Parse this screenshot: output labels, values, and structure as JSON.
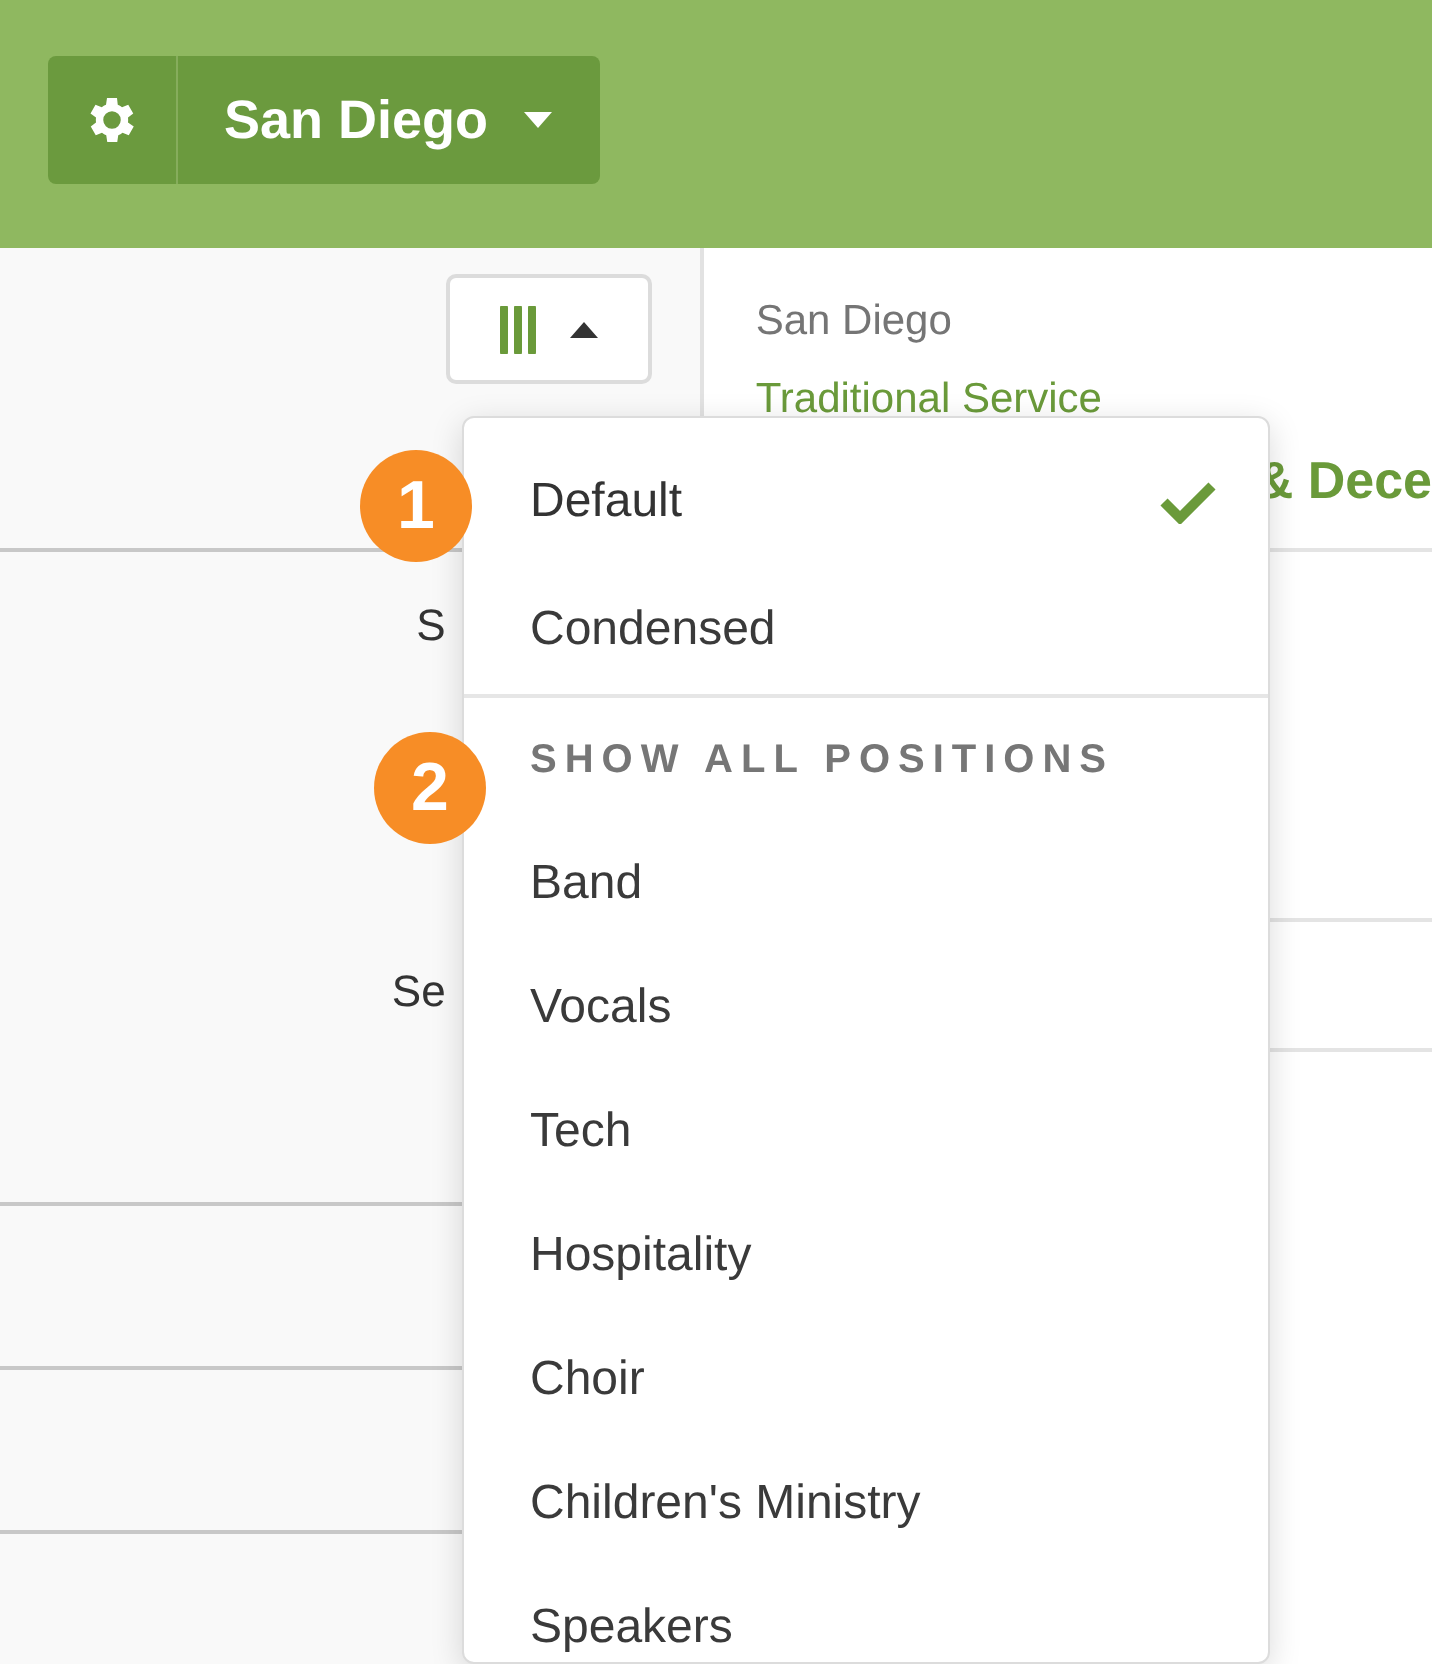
{
  "header": {
    "location": "San Diego"
  },
  "left_rows": [
    {
      "cells": [
        "S",
        "Se"
      ]
    },
    {
      "cells": []
    },
    {
      "cells": []
    }
  ],
  "service": {
    "campus": "San Diego",
    "name": "Traditional Service",
    "heading": "& Dece"
  },
  "view_menu": {
    "expanded": true,
    "layouts": [
      {
        "label": "Default",
        "selected": true
      },
      {
        "label": "Condensed",
        "selected": false
      }
    ],
    "section_title": "SHOW ALL POSITIONS",
    "positions": [
      "Band",
      "Vocals",
      "Tech",
      "Hospitality",
      "Choir",
      "Children's Ministry",
      "Speakers"
    ]
  },
  "callouts": [
    "1",
    "2"
  ]
}
